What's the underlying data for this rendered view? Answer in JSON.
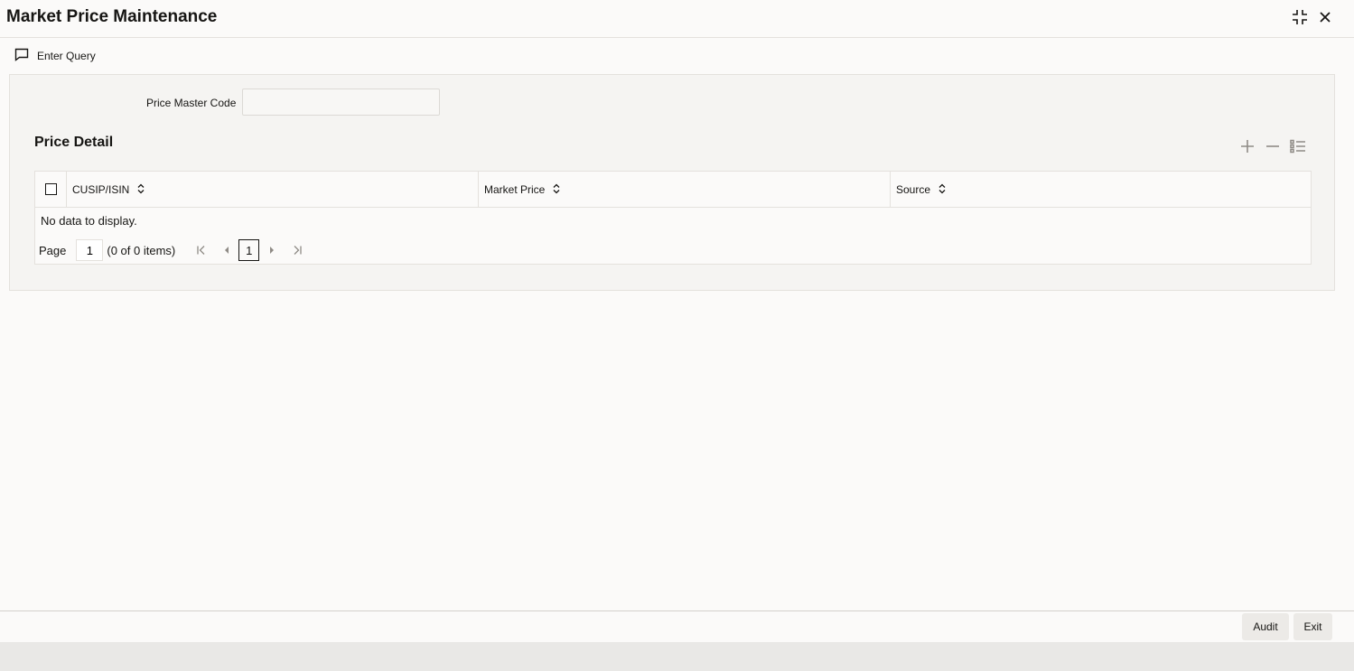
{
  "window": {
    "title": "Market Price Maintenance",
    "icons": {
      "restore": "compress-icon",
      "close": "close-icon"
    }
  },
  "toolbar": {
    "enter_query_label": "Enter Query",
    "enter_query_icon": "comment-icon"
  },
  "form": {
    "price_master_code": {
      "label": "Price Master Code",
      "value": ""
    }
  },
  "price_detail": {
    "title": "Price Detail",
    "actions": {
      "add": "plus-icon",
      "remove": "minus-icon",
      "details": "list-icon"
    },
    "columns": [
      "CUSIP/ISIN",
      "Market Price",
      "Source"
    ],
    "rows": [],
    "empty_text": "No data to display.",
    "pagination": {
      "page_label": "Page",
      "page_value": "1",
      "items_text": "(0 of 0 items)",
      "current_page": "1"
    }
  },
  "footer": {
    "audit_label": "Audit",
    "exit_label": "Exit"
  },
  "colors": {
    "background": "#fbfaf9",
    "panel": "#f5f4f2",
    "border": "#e4e1dd",
    "text": "#161513",
    "button": "#eceae7",
    "statusbar": "#e9e8e6"
  }
}
